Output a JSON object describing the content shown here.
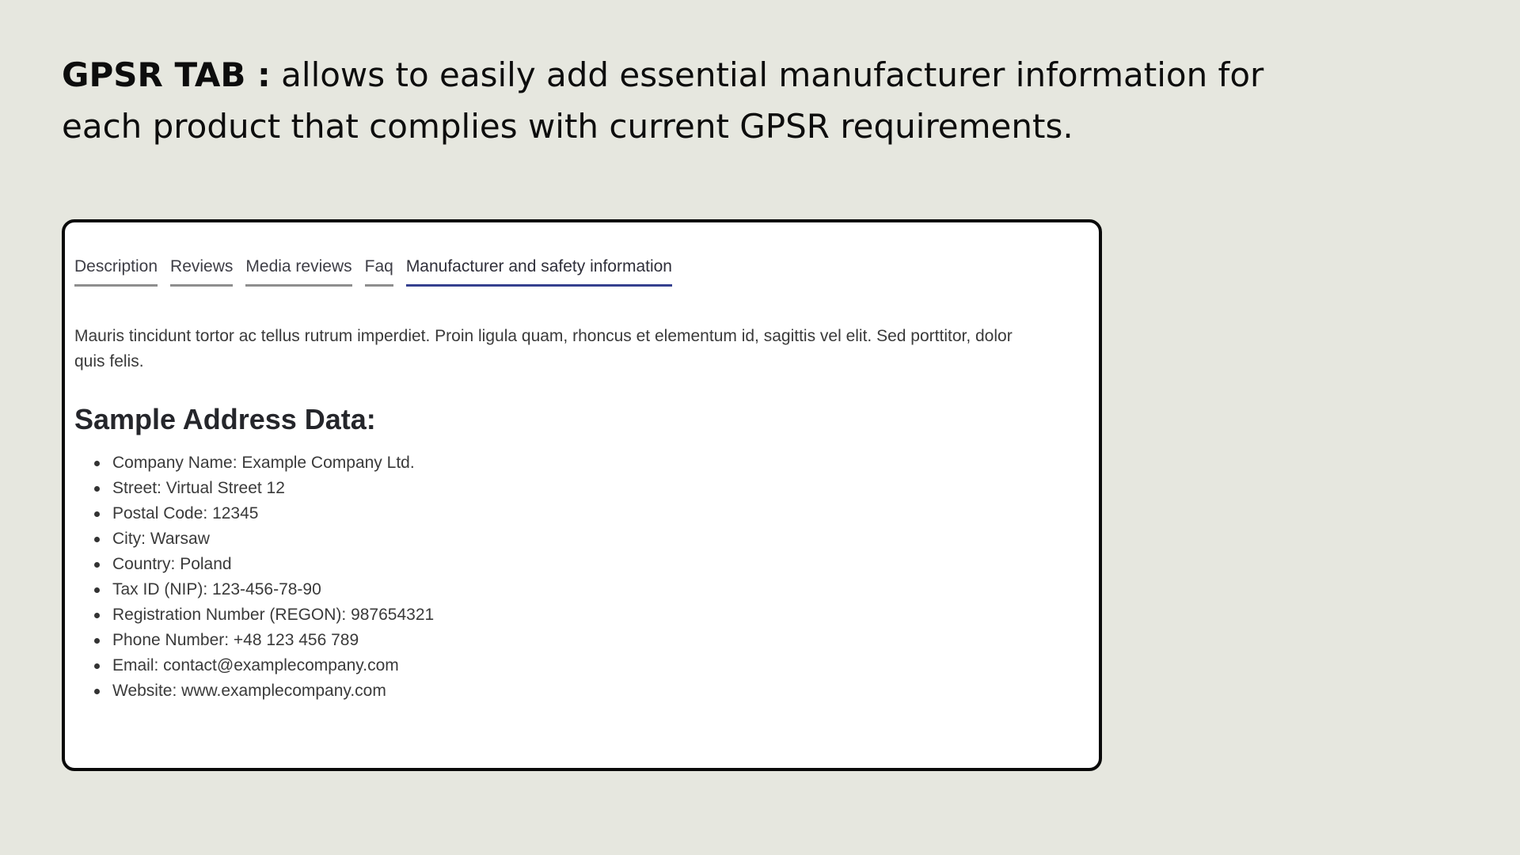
{
  "headline": {
    "bold": "GPSR TAB :",
    "text": "allows to easily add essential manufacturer information for each product that complies with current GPSR requirements."
  },
  "tabs": [
    {
      "label": "Description",
      "active": false
    },
    {
      "label": "Reviews",
      "active": false
    },
    {
      "label": "Media reviews",
      "active": false
    },
    {
      "label": "Faq",
      "active": false
    },
    {
      "label": "Manufacturer and safety information",
      "active": true
    }
  ],
  "content": {
    "intro": "Mauris tincidunt tortor ac tellus rutrum imperdiet. Proin ligula quam, rhoncus et elementum id, sagittis vel elit. Sed porttitor, dolor\nquis felis.",
    "section_title": "Sample Address Data:",
    "address_items": [
      "Company Name: Example Company Ltd.",
      "Street: Virtual Street 12",
      "Postal Code: 12345",
      "City: Warsaw",
      "Country: Poland",
      "Tax ID (NIP): 123-456-78-90",
      "Registration Number (REGON): 987654321",
      "Phone Number: +48 123 456 789",
      "Email: contact@examplecompany.com",
      "Website: www.examplecompany.com"
    ]
  },
  "colors": {
    "background": "#e6e7df",
    "active_tab_underline": "#35408f",
    "inactive_tab_underline": "#8e8e8e"
  }
}
